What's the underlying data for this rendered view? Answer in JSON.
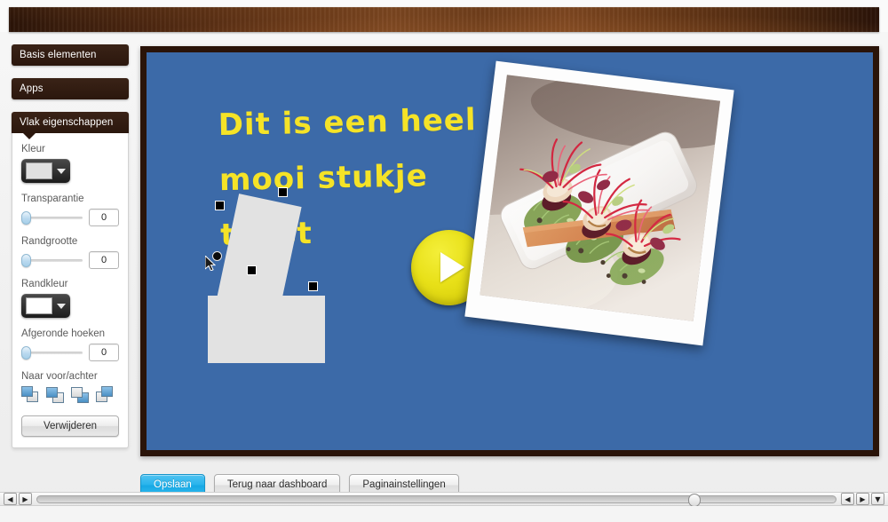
{
  "app": {
    "topbar_label": "wood-texture-toolbar"
  },
  "sidebar": {
    "collapsed_panels": [
      {
        "label": "Basis elementen",
        "name": "basis-elementen"
      },
      {
        "label": "Apps",
        "name": "apps"
      }
    ],
    "properties_panel": {
      "title": "Vlak eigenschappen",
      "fields": {
        "fill_color": {
          "label": "Kleur",
          "swatch_hex": "#e0e0e0",
          "caret_icon": "chevron-down-icon"
        },
        "transparency": {
          "label": "Transparantie",
          "value": "0",
          "slider_percent": 0
        },
        "border_size": {
          "label": "Randgrootte",
          "value": "0",
          "slider_percent": 0
        },
        "border_color": {
          "label": "Randkleur",
          "swatch_hex": "#ffffff",
          "caret_icon": "chevron-down-icon"
        },
        "rounded_corners": {
          "label": "Afgeronde hoeken",
          "value": "0",
          "slider_percent": 0
        },
        "arrange": {
          "label": "Naar voor/achter",
          "buttons": [
            {
              "name": "bring-to-front-icon",
              "title": "Naar voren"
            },
            {
              "name": "bring-forward-icon",
              "title": "Een naar voren"
            },
            {
              "name": "send-backward-icon",
              "title": "Een naar achteren"
            },
            {
              "name": "send-to-back-icon",
              "title": "Naar achteren"
            }
          ]
        }
      },
      "delete_label": "Verwijderen"
    }
  },
  "canvas": {
    "background_hex": "#3c6aa8",
    "frame_hex": "#2a1409",
    "slide_text": "Dit is een heel mooi stukje tekst",
    "slide_text_hex": "#f5e327",
    "play_button": {
      "name": "play-button",
      "color_hex": "#e8e018",
      "icon": "play-triangle-icon"
    },
    "photo": {
      "name": "food-photo",
      "caption": "",
      "alt": "Gourmet dish: seared scallops on wooden plank with micro greens and red chard on a white plate"
    },
    "shapes": [
      {
        "name": "rectangle-shape",
        "selected": false,
        "fill_hex": "#e2e2e2"
      },
      {
        "name": "rotated-rectangle-shape",
        "selected": true,
        "fill_hex": "#e2e2e2",
        "rotation_deg": 12
      }
    ]
  },
  "actions": {
    "save_label": "Opslaan",
    "dashboard_label": "Terug naar dashboard",
    "page_settings_label": "Paginainstellingen"
  },
  "scrollbar": {
    "left_prev_icon": "◀",
    "left_next_icon": "▶",
    "right_prev_icon": "◀",
    "right_next_icon": "▶",
    "right_menu_icon": "▼",
    "thumb_position_percent": 81.5
  }
}
